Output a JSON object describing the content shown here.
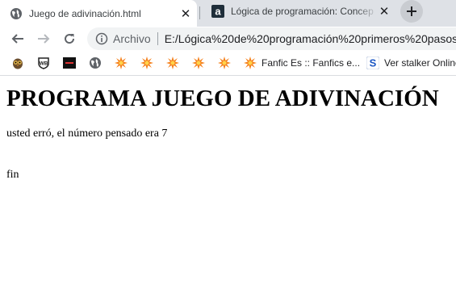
{
  "tabs": [
    {
      "title": "Juego de adivinación.html",
      "active": true,
      "favicon": "globe-icon"
    },
    {
      "title": "Lógica de programación: Concep",
      "active": false,
      "favicon": "alura-a-icon"
    }
  ],
  "toolbar": {
    "scheme_label": "Archivo",
    "url": "E:/Lógica%20de%20programación%20primeros%20pasos/"
  },
  "bookmarks": [
    {
      "icon": "owl-icon",
      "label": ""
    },
    {
      "icon": "warner-bros-icon",
      "label": ""
    },
    {
      "icon": "dark-tile-icon",
      "label": ""
    },
    {
      "icon": "globe-icon",
      "label": ""
    },
    {
      "icon": "orange-burst-icon",
      "label": ""
    },
    {
      "icon": "orange-burst-icon",
      "label": ""
    },
    {
      "icon": "orange-burst-icon",
      "label": ""
    },
    {
      "icon": "orange-burst-icon",
      "label": ""
    },
    {
      "icon": "orange-burst-icon",
      "label": ""
    },
    {
      "icon": "orange-burst-icon",
      "label": "Fanfic Es :: Fanfics e..."
    },
    {
      "icon": "s-badge-icon",
      "label": "Ver stalker Online"
    }
  ],
  "page": {
    "heading": "PROGRAMA JUEGO DE ADIVINACIÓN",
    "message": "usted erró, el número pensado era 7",
    "end_text": "fin"
  },
  "colors": {
    "tabstrip": "#dee1e6",
    "omnibox": "#f1f3f4",
    "burst": "#f5821f"
  }
}
